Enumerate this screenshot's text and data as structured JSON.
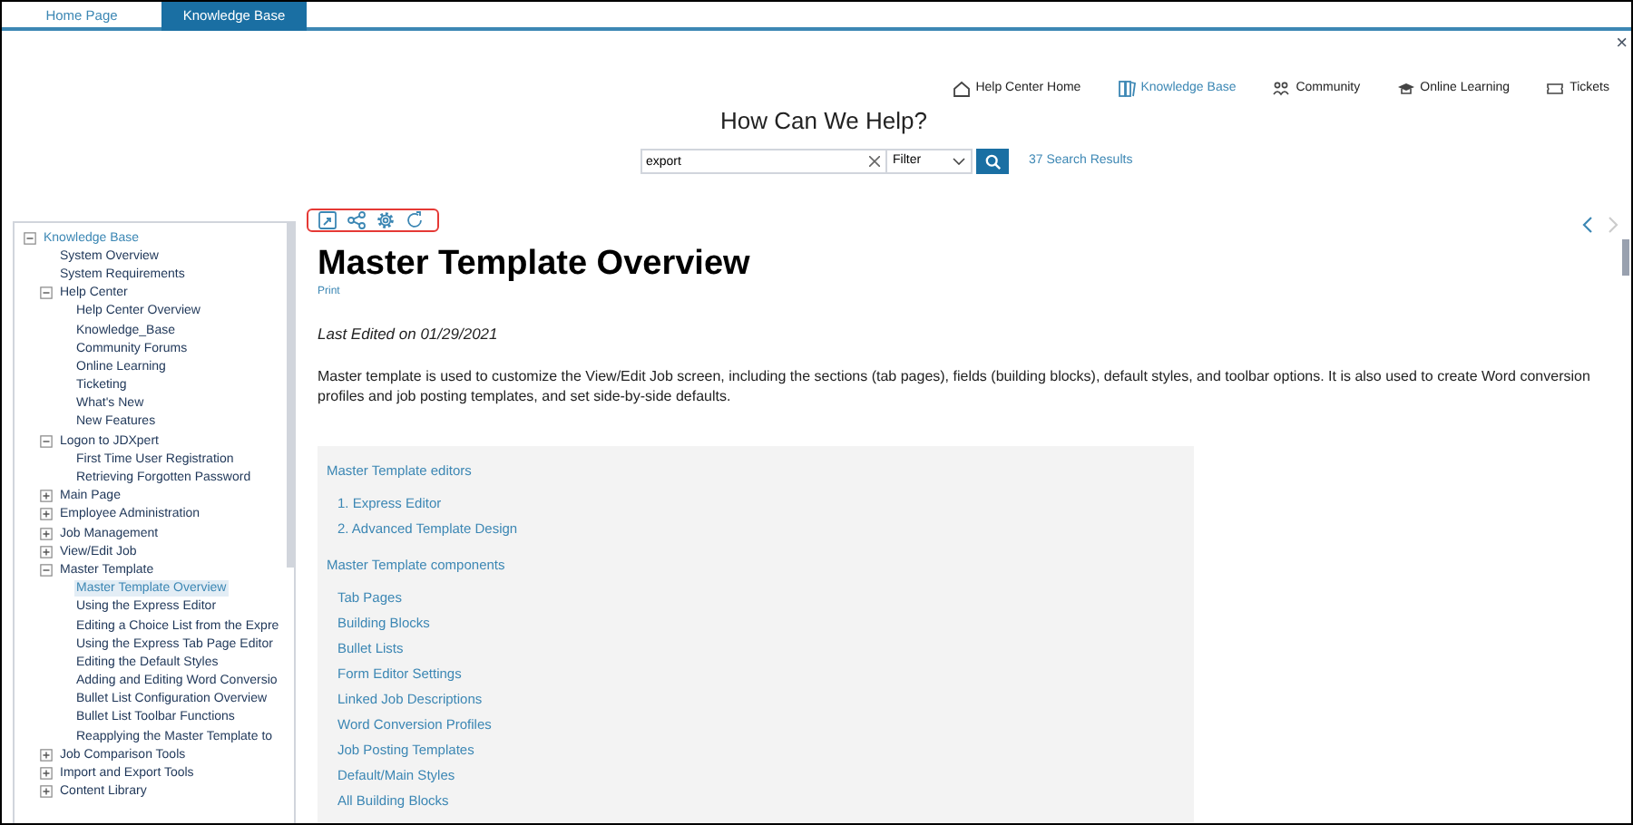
{
  "tabs": [
    {
      "label": "Home Page",
      "selected": false
    },
    {
      "label": "Knowledge Base",
      "selected": true
    }
  ],
  "close": "×",
  "nav_links": [
    {
      "label": "Help Center Home",
      "kind": "home",
      "selected": false
    },
    {
      "label": "Knowledge Base",
      "kind": "book",
      "selected": true
    },
    {
      "label": "Community",
      "kind": "people",
      "selected": false
    },
    {
      "label": "Online Learning",
      "kind": "cap",
      "selected": false
    },
    {
      "label": "Tickets",
      "kind": "ticket",
      "selected": false
    }
  ],
  "heading": "How Can We Help?",
  "search": {
    "value": "export",
    "filter": "Filter",
    "results": "37 Search Results"
  },
  "tree": [
    {
      "label": "Knowledge Base",
      "expanded": true,
      "selected": false,
      "children": [
        {
          "label": "System Overview",
          "selected": false
        },
        {
          "label": "System Requirements",
          "selected": false
        },
        {
          "label": "Help Center",
          "expanded": true,
          "selected": false,
          "children": [
            {
              "label": "Help Center Overview",
              "selected": false
            },
            {
              "label": "Knowledge_Base",
              "selected": false
            },
            {
              "label": "Community Forums",
              "selected": false
            },
            {
              "label": "Online Learning",
              "selected": false
            },
            {
              "label": "Ticketing",
              "selected": false
            },
            {
              "label": "What's New",
              "selected": false
            },
            {
              "label": "New Features",
              "selected": false
            }
          ]
        },
        {
          "label": "Logon to JDXpert",
          "expanded": true,
          "selected": false,
          "children": [
            {
              "label": "First Time User Registration",
              "selected": false
            },
            {
              "label": "Retrieving Forgotten Password",
              "selected": false
            }
          ]
        },
        {
          "label": "Main Page",
          "expanded": false,
          "selected": false
        },
        {
          "label": "Employee Administration",
          "expanded": false,
          "selected": false
        },
        {
          "label": "Job Management",
          "expanded": false,
          "selected": false
        },
        {
          "label": "View/Edit Job",
          "expanded": false,
          "selected": false
        },
        {
          "label": "Master Template",
          "expanded": true,
          "selected": false,
          "children": [
            {
              "label": "Master Template Overview",
              "selected": true
            },
            {
              "label": "Using the Express Editor",
              "selected": false
            },
            {
              "label": "Editing a Choice List from the Expre",
              "selected": false
            },
            {
              "label": "Using the Express Tab Page Editor",
              "selected": false
            },
            {
              "label": "Editing the Default Styles",
              "selected": false
            },
            {
              "label": "Adding and Editing Word Conversio",
              "selected": false
            },
            {
              "label": "Bullet List Configuration Overview",
              "selected": false
            },
            {
              "label": "Bullet List Toolbar Functions",
              "selected": false
            },
            {
              "label": "Reapplying the Master Template to",
              "selected": false
            }
          ]
        },
        {
          "label": "Job Comparison Tools",
          "expanded": false,
          "selected": false
        },
        {
          "label": "Import and Export Tools",
          "expanded": false,
          "selected": false
        },
        {
          "label": "Content Library",
          "expanded": false,
          "selected": false
        }
      ]
    }
  ],
  "article": {
    "title": "Master Template Overview",
    "print": "Print",
    "last_edited": "Last Edited on 01/29/2021",
    "body": "Master template is used to customize the View/Edit Job screen, including the sections (tab pages), fields (building blocks), default styles, and toolbar options. It is also used to create Word conversion profiles and job posting templates, and set side-by-side defaults.",
    "sections": [
      {
        "heading": "Master Template editors",
        "links": [
          "1. Express Editor",
          "2. Advanced Template Design"
        ]
      },
      {
        "heading": "Master Template components",
        "links": [
          "Tab Pages",
          "Building Blocks",
          "Bullet Lists",
          "Form Editor Settings",
          "Linked Job Descriptions",
          "Word Conversion Profiles",
          "Job Posting Templates",
          "Default/Main Styles",
          "All Building Blocks"
        ]
      }
    ]
  }
}
